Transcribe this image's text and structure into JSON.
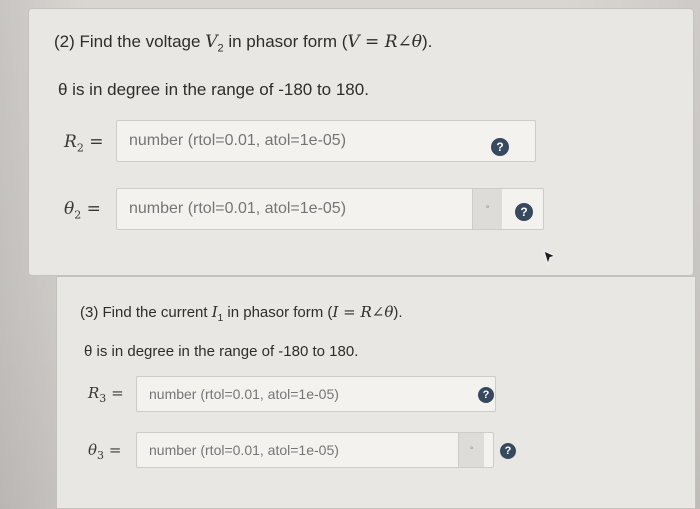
{
  "q2": {
    "title_prefix": "(2) Find the voltage ",
    "title_var": "V",
    "title_sub": "2",
    "title_mid": " in phasor form (",
    "title_formula": "V = R∠θ",
    "title_suffix": ").",
    "note": "θ is in degree in the range of -180 to 180.",
    "rows": [
      {
        "symbol": "R",
        "sub": "2",
        "eq": "=",
        "placeholder": "number (rtol=0.01, atol=1e-05)",
        "help": "?",
        "icon": "question-circle-icon"
      },
      {
        "symbol": "θ",
        "sub": "2",
        "eq": "=",
        "placeholder": "number (rtol=0.01, atol=1e-05)",
        "help": "?",
        "icon": "question-circle-icon"
      }
    ]
  },
  "q3": {
    "title_prefix": "(3) Find the current ",
    "title_var": "I",
    "title_sub": "1",
    "title_mid": " in phasor form (",
    "title_formula": "I = R∠θ",
    "title_suffix": ").",
    "note": "θ is in degree in the range of -180 to 180.",
    "rows": [
      {
        "symbol": "R",
        "sub": "3",
        "eq": "=",
        "placeholder": "number (rtol=0.01, atol=1e-05)",
        "help": "?",
        "icon": "question-circle-icon"
      },
      {
        "symbol": "θ",
        "sub": "3",
        "eq": "=",
        "placeholder": "number (rtol=0.01, atol=1e-05)",
        "help": "?",
        "icon": "question-circle-icon"
      }
    ]
  },
  "status_glyph": "°",
  "colors": {
    "help_bg": "#36495f",
    "card_bg": "#e9e7e4",
    "field_bg": "#f3f2ef"
  },
  "cursor_icon": "mouse-pointer-icon"
}
